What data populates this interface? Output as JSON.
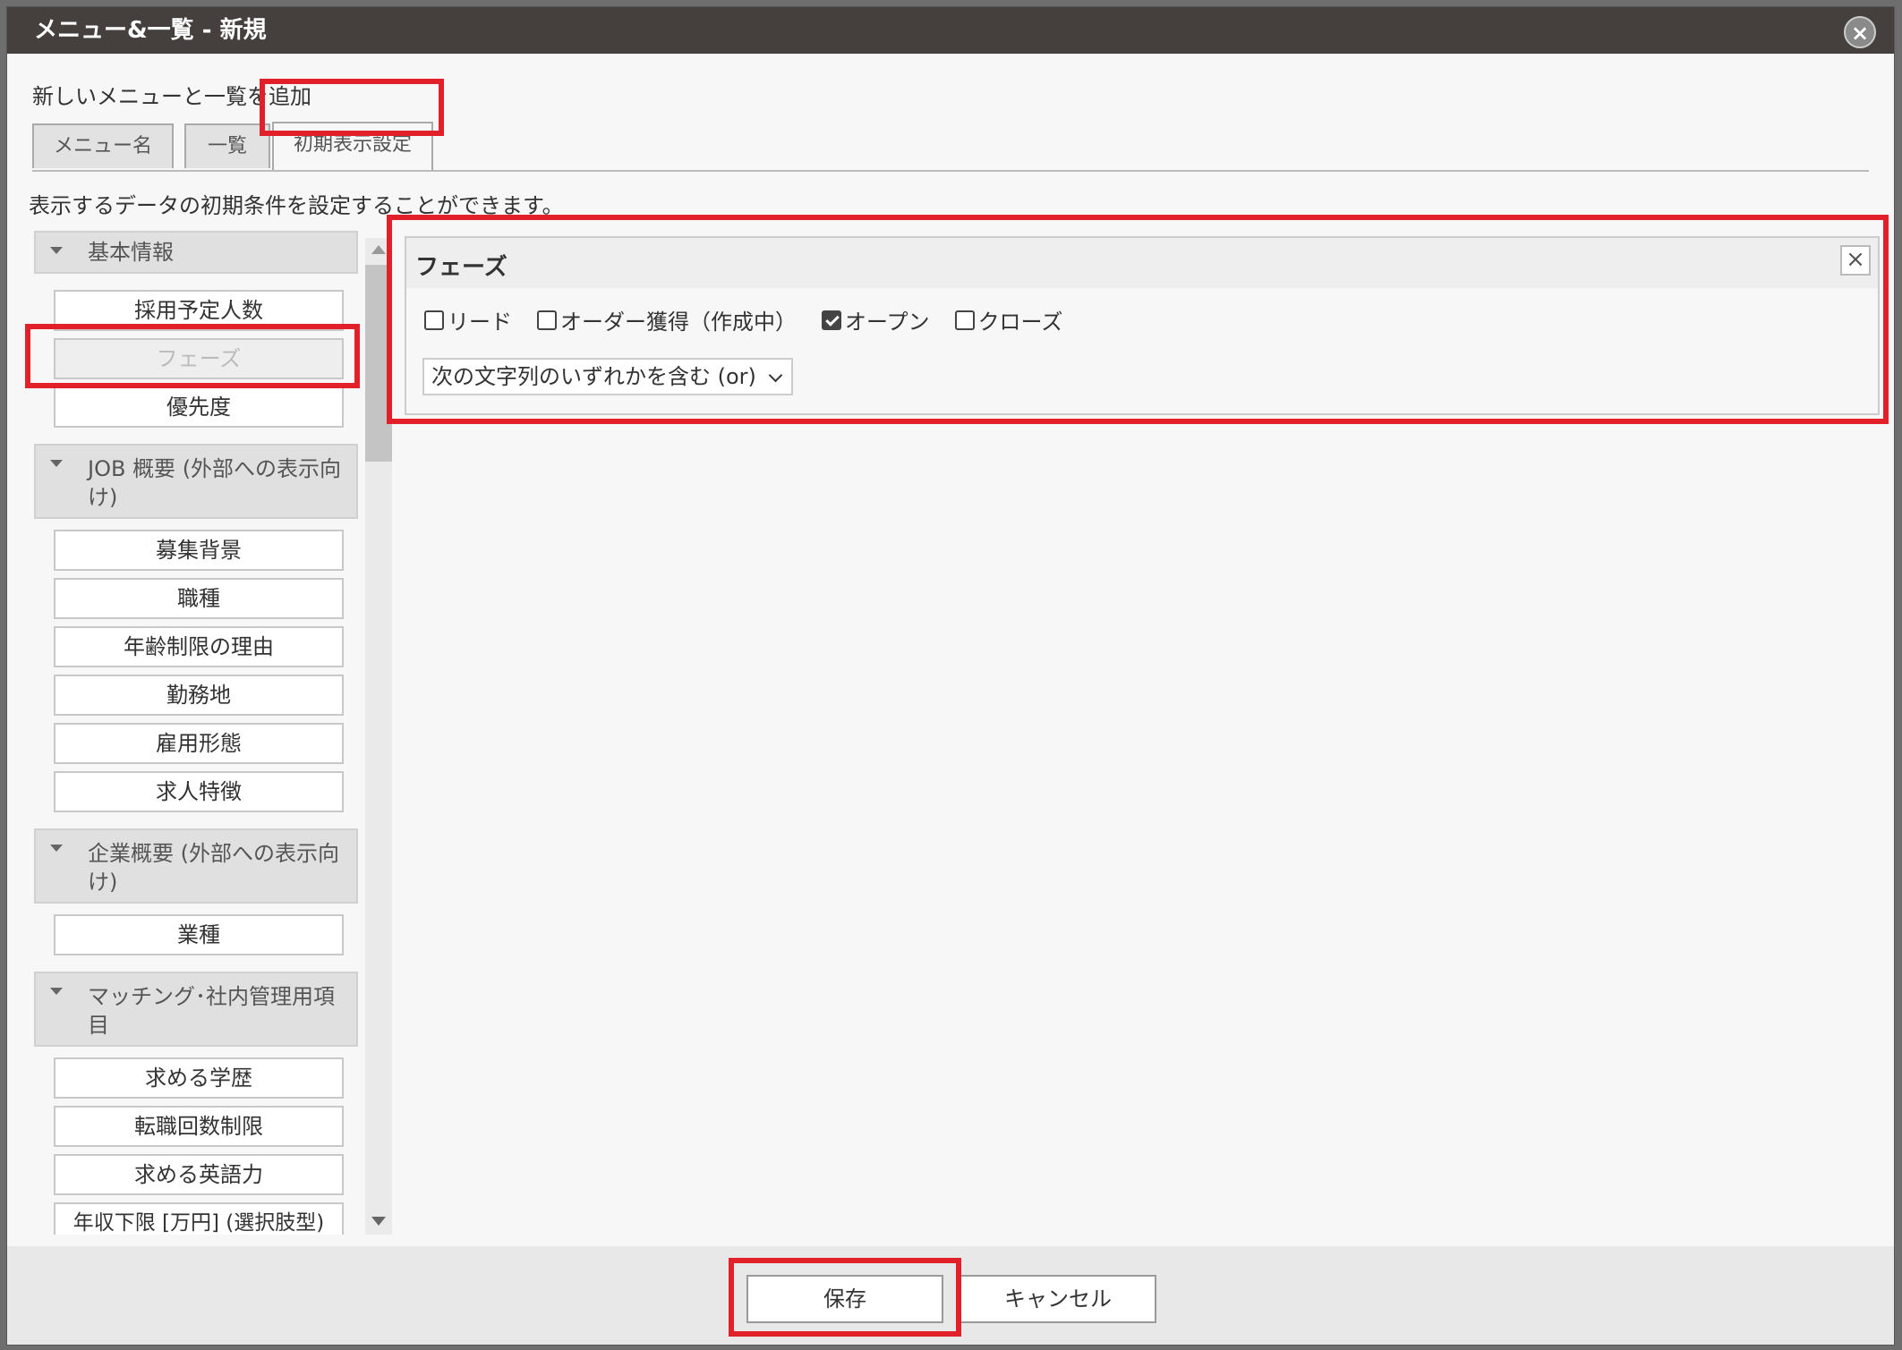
{
  "dialog": {
    "title": "メニュー&一覧 - 新規",
    "close_symbol": "×",
    "subtitle": "新しいメニューと一覧を追加",
    "tabs": [
      {
        "label": "メニュー名"
      },
      {
        "label": "一覧"
      },
      {
        "label": "初期表示設定"
      }
    ],
    "description": "表示するデータの初期条件を設定することができます。"
  },
  "sidebar": {
    "sections": [
      {
        "title": "基本情報",
        "items": [
          "採用予定人数",
          "フェーズ",
          "優先度"
        ]
      },
      {
        "title": "JOB 概要 (外部への表示向け)",
        "items": [
          "募集背景",
          "職種",
          "年齢制限の理由",
          "勤務地",
          "雇用形態",
          "求人特徴"
        ]
      },
      {
        "title": "企業概要 (外部への表示向け)",
        "items": [
          "業種"
        ]
      },
      {
        "title": "マッチング･社内管理用項目",
        "items": [
          "求める学歴",
          "転職回数制限",
          "求める英語力",
          "年収下限 [万円] (選択肢型)"
        ]
      }
    ]
  },
  "filter": {
    "title": "フェーズ",
    "close_symbol": "×",
    "options": [
      {
        "label": "リード",
        "checked": false
      },
      {
        "label": "オーダー獲得（作成中）",
        "checked": false
      },
      {
        "label": "オープン",
        "checked": true
      },
      {
        "label": "クローズ",
        "checked": false
      }
    ],
    "match_mode": "次の文字列のいずれかを含む (or)"
  },
  "footer": {
    "save_label": "保存",
    "cancel_label": "キャンセル"
  },
  "colors": {
    "titlebar": "#453f3d",
    "highlight": "#e1202a"
  }
}
